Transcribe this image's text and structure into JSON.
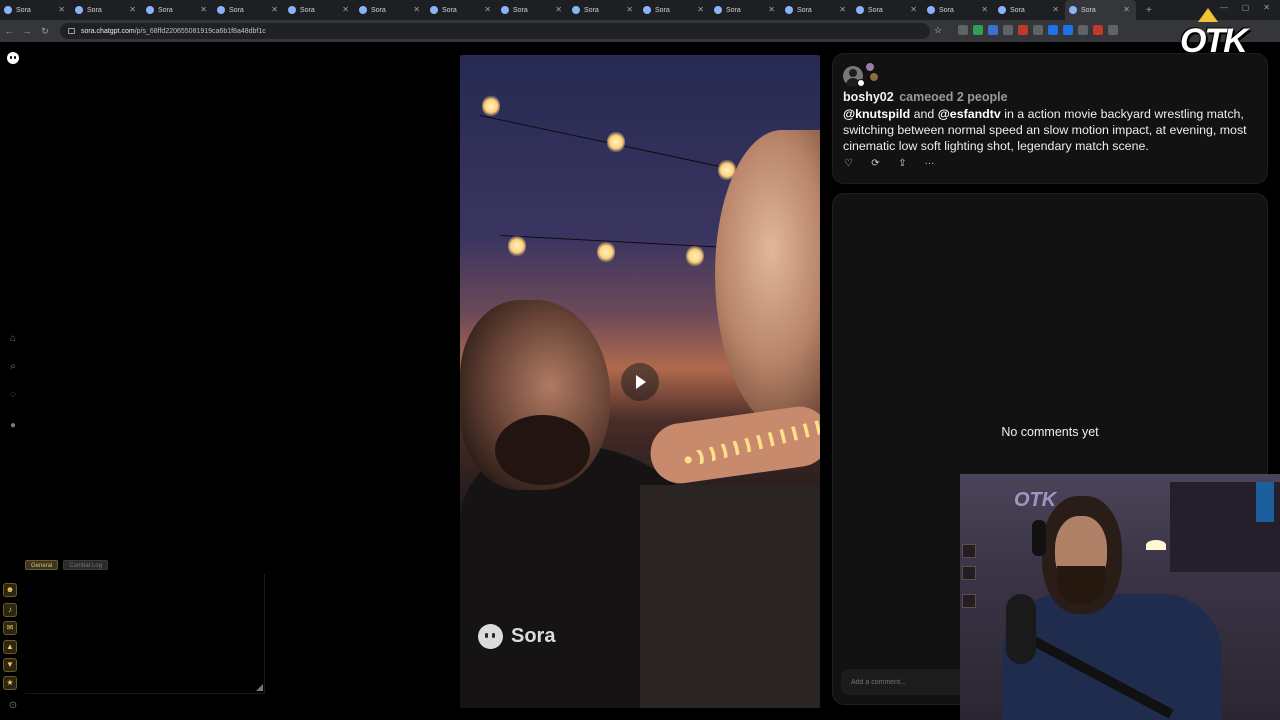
{
  "browser": {
    "tabs": [
      {
        "label": "Sora",
        "active": false
      },
      {
        "label": "Sora",
        "active": false
      },
      {
        "label": "Sora",
        "active": false
      },
      {
        "label": "Sora",
        "active": false
      },
      {
        "label": "Sora",
        "active": false
      },
      {
        "label": "Sora",
        "active": false
      },
      {
        "label": "Sora",
        "active": false
      },
      {
        "label": "Sora",
        "active": false
      },
      {
        "label": "Sora",
        "active": false
      },
      {
        "label": "Sora",
        "active": false
      },
      {
        "label": "Sora",
        "active": false
      },
      {
        "label": "Sora",
        "active": false
      },
      {
        "label": "Sora",
        "active": false
      },
      {
        "label": "Sora",
        "active": false
      },
      {
        "label": "Sora",
        "active": false
      },
      {
        "label": "Sora",
        "active": true
      }
    ],
    "new_tab_icon": "plus-icon",
    "url_host": "sora.chatgpt.com",
    "url_path": "/p/s_68ffd220655081919ca6b1f8a48dbf1c"
  },
  "left_rail": {
    "icons": [
      "sora-logo-icon",
      "home-icon",
      "search-icon",
      "bell-icon",
      "profile-icon"
    ]
  },
  "chat_widget": {
    "tabs": [
      "General",
      "Combat Log"
    ],
    "side_icons": [
      "user-icon",
      "speaker-icon",
      "chat-bubble-icon",
      "up-arrow-icon",
      "down-arrow-icon",
      "pin-icon"
    ]
  },
  "video": {
    "watermark": "Sora",
    "play_icon": "play-icon"
  },
  "post": {
    "username": "boshy02",
    "cameo_text": "cameoed 2 people",
    "mention_1": "@knutspild",
    "and_text": " and ",
    "mention_2": "@esfandtv",
    "caption_rest": " in a action movie backyard wrestling match, switching between normal speed an slow motion impact, at evening, most cinematic low soft lighting shot, legendary match scene.",
    "actions": [
      "heart-icon",
      "remix-icon",
      "share-icon",
      "more-icon"
    ]
  },
  "comments": {
    "empty_text": "No comments yet",
    "input_placeholder": "Add a comment..."
  },
  "overlay": {
    "brand_text": "OTK",
    "cam_logo": "OTK"
  },
  "colors": {
    "page_bg": "#000000",
    "card_bg": "#121212",
    "accent_gold": "#f2c94c"
  }
}
